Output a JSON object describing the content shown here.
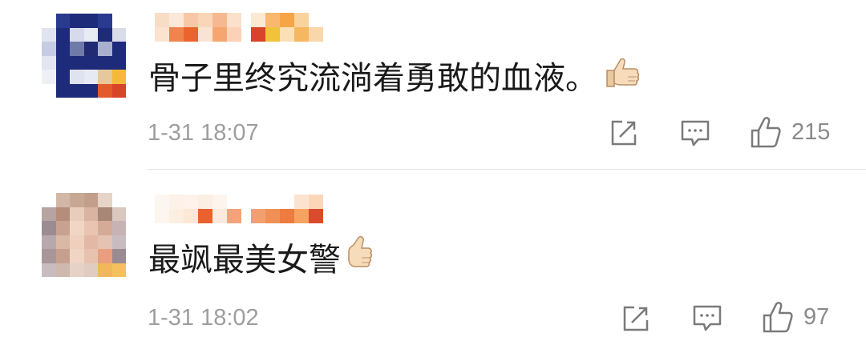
{
  "comments": [
    {
      "text": "骨子里终究流淌着勇敢的血液。",
      "timestamp": "1-31 18:07",
      "like_count": "215"
    },
    {
      "text": "最飒最美女警",
      "timestamp": "1-31 18:02",
      "like_count": "97"
    }
  ],
  "icons": {
    "share": "share-icon",
    "comment": "comment-icon",
    "like": "thumbs-up-icon",
    "emoji": "thumbs-up-emoji"
  },
  "colors": {
    "text": "#1a1a1a",
    "meta": "#9e9e9e",
    "icon": "#7a7a7a",
    "divider": "#e6e6e6"
  }
}
